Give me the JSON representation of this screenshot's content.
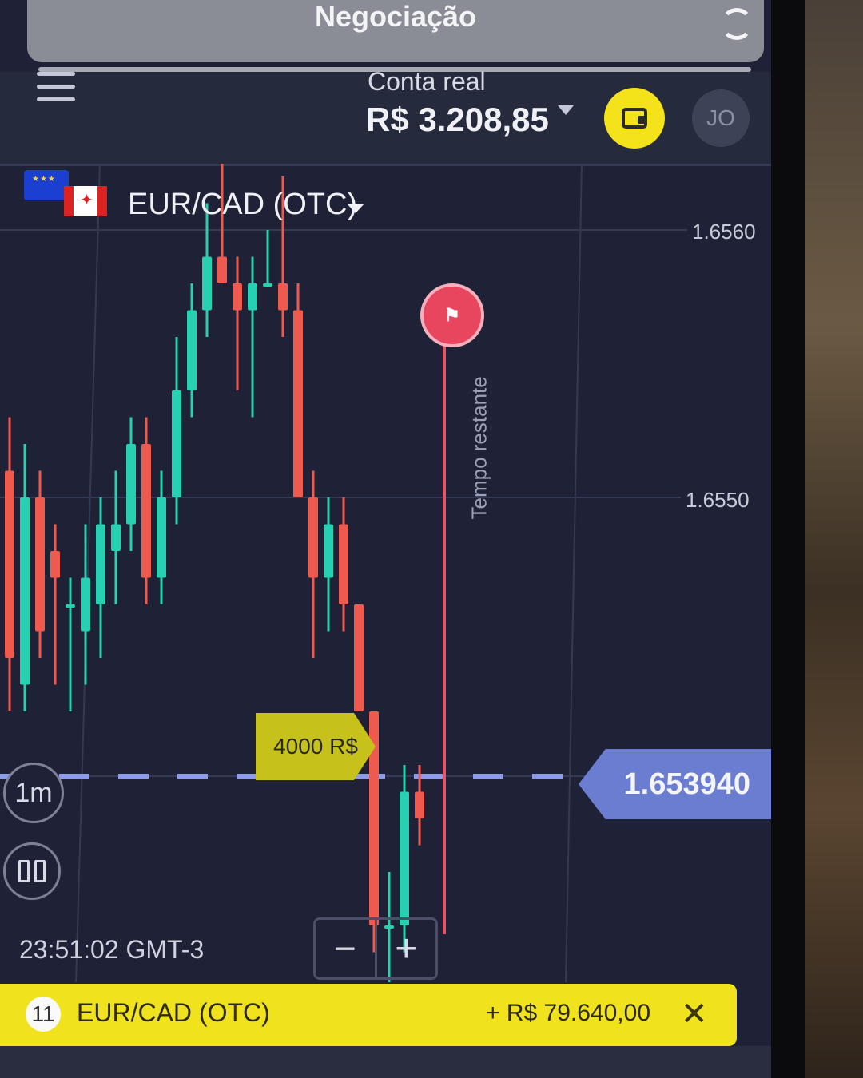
{
  "top_sheet": {
    "title": "Negociação"
  },
  "header": {
    "account_label": "Conta real",
    "balance": "R$ 3.208,85",
    "avatar_initials": "JO"
  },
  "asset": {
    "name": "EUR/CAD (OTC)"
  },
  "chart": {
    "price_labels": [
      "1.6560",
      "1.6550"
    ],
    "current_price": "1.653940",
    "timer_label": "Tempo restante",
    "trade_tag": "4000 R$",
    "timeframe": "1m",
    "clock": "23:51:02 GMT-3"
  },
  "zoom": {
    "minus": "−",
    "plus": "+"
  },
  "bottom_bar": {
    "count": "11",
    "asset": "EUR/CAD (OTC)",
    "profit": "+ R$ 79.640,00",
    "close": "✕"
  },
  "colors": {
    "up": "#26d0b0",
    "down": "#f0594e",
    "accent": "#f0e21d",
    "timer": "#e8465f",
    "price_tag": "#6b7dd1"
  },
  "chart_data": {
    "type": "candlestick",
    "candles": [
      {
        "o": 1.6551,
        "h": 1.6553,
        "l": 1.6542,
        "c": 1.6544
      },
      {
        "o": 1.6543,
        "h": 1.6552,
        "l": 1.6542,
        "c": 1.655
      },
      {
        "o": 1.655,
        "h": 1.6551,
        "l": 1.6544,
        "c": 1.6545
      },
      {
        "o": 1.6548,
        "h": 1.6549,
        "l": 1.6543,
        "c": 1.6547
      },
      {
        "o": 1.6546,
        "h": 1.6547,
        "l": 1.6542,
        "c": 1.6546
      },
      {
        "o": 1.6545,
        "h": 1.6549,
        "l": 1.6543,
        "c": 1.6547
      },
      {
        "o": 1.6546,
        "h": 1.655,
        "l": 1.6544,
        "c": 1.6549
      },
      {
        "o": 1.6548,
        "h": 1.6551,
        "l": 1.6546,
        "c": 1.6549
      },
      {
        "o": 1.6549,
        "h": 1.6553,
        "l": 1.6548,
        "c": 1.6552
      },
      {
        "o": 1.6552,
        "h": 1.6553,
        "l": 1.6546,
        "c": 1.6547
      },
      {
        "o": 1.6547,
        "h": 1.6551,
        "l": 1.6546,
        "c": 1.655
      },
      {
        "o": 1.655,
        "h": 1.6556,
        "l": 1.6549,
        "c": 1.6554
      },
      {
        "o": 1.6554,
        "h": 1.6558,
        "l": 1.6553,
        "c": 1.6557
      },
      {
        "o": 1.6557,
        "h": 1.6561,
        "l": 1.6556,
        "c": 1.6559
      },
      {
        "o": 1.6559,
        "h": 1.6563,
        "l": 1.6558,
        "c": 1.6558
      },
      {
        "o": 1.6558,
        "h": 1.6559,
        "l": 1.6554,
        "c": 1.6557
      },
      {
        "o": 1.6557,
        "h": 1.6559,
        "l": 1.6553,
        "c": 1.6558
      },
      {
        "o": 1.6558,
        "h": 1.656,
        "l": 1.6558,
        "c": 1.6558
      },
      {
        "o": 1.6558,
        "h": 1.6562,
        "l": 1.6556,
        "c": 1.6557
      },
      {
        "o": 1.6557,
        "h": 1.6558,
        "l": 1.655,
        "c": 1.655
      },
      {
        "o": 1.655,
        "h": 1.6551,
        "l": 1.6544,
        "c": 1.6547
      },
      {
        "o": 1.6547,
        "h": 1.655,
        "l": 1.6545,
        "c": 1.6549
      },
      {
        "o": 1.6549,
        "h": 1.655,
        "l": 1.6545,
        "c": 1.6546
      },
      {
        "o": 1.6546,
        "h": 1.6546,
        "l": 1.6542,
        "c": 1.6542
      },
      {
        "o": 1.6542,
        "h": 1.6542,
        "l": 1.6533,
        "c": 1.6534
      },
      {
        "o": 1.6534,
        "h": 1.6536,
        "l": 1.6531,
        "c": 1.6534
      },
      {
        "o": 1.6534,
        "h": 1.654,
        "l": 1.6533,
        "c": 1.6539
      },
      {
        "o": 1.6539,
        "h": 1.654,
        "l": 1.6537,
        "c": 1.6538
      }
    ]
  }
}
